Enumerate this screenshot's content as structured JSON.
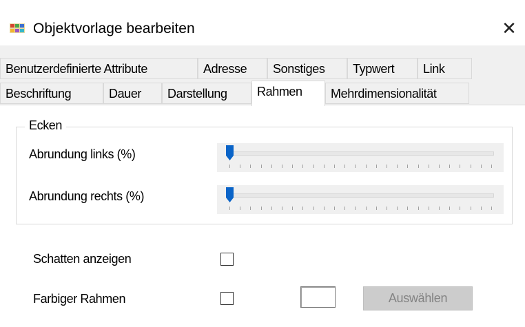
{
  "window": {
    "title": "Objektvorlage bearbeiten",
    "close_glyph": "✕",
    "icon": "palette-icon"
  },
  "tabs": {
    "row1": [
      {
        "label": "Benutzerdefinierte Attribute"
      },
      {
        "label": "Adresse"
      },
      {
        "label": "Sonstiges"
      },
      {
        "label": "Typwert"
      },
      {
        "label": "Link"
      }
    ],
    "row2": [
      {
        "label": "Beschriftung"
      },
      {
        "label": "Dauer"
      },
      {
        "label": "Darstellung"
      },
      {
        "label": "Rahmen",
        "active": true
      },
      {
        "label": "Mehrdimensionalität"
      }
    ]
  },
  "corners": {
    "group_title": "Ecken",
    "left_label": "Abrundung links (%)",
    "left_value_percent": 0,
    "right_label": "Abrundung rechts (%)",
    "right_value_percent": 0
  },
  "options": {
    "shadow_label": "Schatten anzeigen",
    "shadow_checked": false,
    "colored_frame_label": "Farbiger Rahmen",
    "colored_frame_checked": false,
    "choose_button": "Auswählen",
    "choose_button_enabled": false
  },
  "colors": {
    "slider_thumb": "#0a64c8",
    "panel_bg": "#f0f0f0",
    "disabled_button_bg": "#cccccc"
  }
}
